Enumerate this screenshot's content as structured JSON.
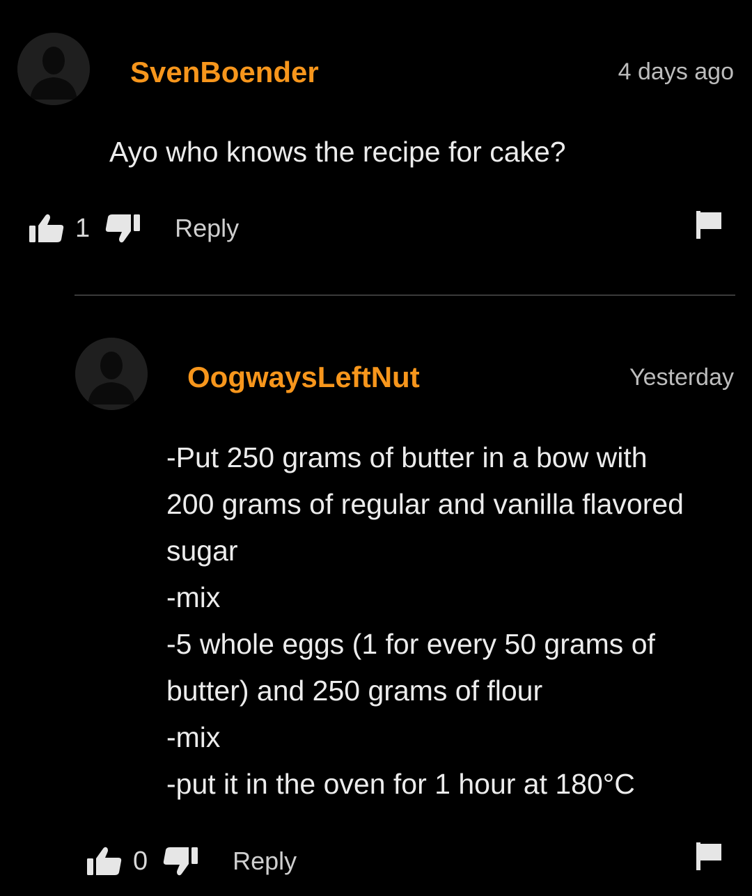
{
  "colors": {
    "background": "#000000",
    "username": "#f7961c",
    "text": "#ececec",
    "muted": "#bdbdbd",
    "icon": "#e6e6e6"
  },
  "comments": [
    {
      "username": "SvenBoender",
      "timestamp": "4 days ago",
      "text_lines": [
        "Ayo who knows the recipe for cake?"
      ],
      "likes": "1",
      "reply_label": "Reply",
      "avatar_icon": "user-silhouette-icon"
    },
    {
      "username": "OogwaysLeftNut",
      "timestamp": "Yesterday",
      "text_lines": [
        "-Put 250 grams of butter in a bow with",
        "200 grams of regular and vanilla flavored",
        "sugar",
        "-mix",
        "-5 whole eggs (1 for every 50 grams of",
        "butter) and 250 grams of flour",
        "-mix",
        "-put it in the oven for 1 hour at 180°C"
      ],
      "likes": "0",
      "reply_label": "Reply",
      "avatar_icon": "user-silhouette-icon"
    }
  ]
}
